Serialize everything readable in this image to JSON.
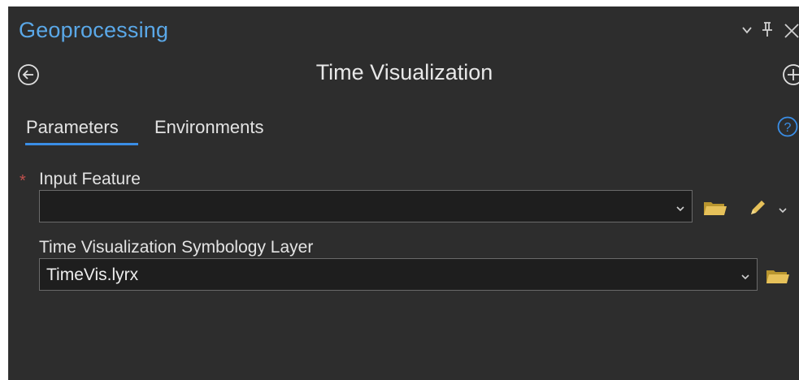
{
  "pane": {
    "title": "Geoprocessing",
    "controls": [
      "chevron-down-icon",
      "pin-icon",
      "close-icon"
    ]
  },
  "tool": {
    "title": "Time Visualization",
    "back_icon": "back-arrow-icon",
    "add_icon": "add-icon"
  },
  "tabs": [
    {
      "label": "Parameters",
      "active": true
    },
    {
      "label": "Environments",
      "active": false
    }
  ],
  "help_icon": "help-icon",
  "parameters": {
    "input_feature": {
      "label": "Input Feature",
      "required": true,
      "required_marker": "*",
      "value": ""
    },
    "symbology_layer": {
      "label": "Time Visualization Symbology Layer",
      "required": false,
      "value": "TimeVis.lyrx"
    }
  },
  "colors": {
    "panel_bg": "#2d2d2d",
    "title_blue": "#5aa8e8",
    "tab_underline": "#3a8ee6",
    "folder_yellow": "#e6c15a",
    "required_red": "#c0504d"
  }
}
